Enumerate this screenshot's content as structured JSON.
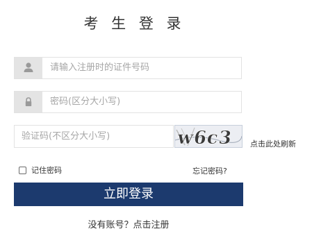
{
  "page": {
    "title": "考 生 登 录"
  },
  "form": {
    "id_number": {
      "placeholder": "请输入注册时的证件号码",
      "icon": "user-icon"
    },
    "password": {
      "placeholder": "密码(区分大小写)",
      "icon": "lock-icon"
    },
    "captcha": {
      "placeholder": "验证码(不区分大小写)",
      "image_text": "w6c3",
      "refresh_label": "点击此处刷新"
    },
    "remember_label": "记住密码",
    "forgot_label": "忘记密码?",
    "submit_label": "立即登录",
    "register_label": "没有账号？点击注册"
  },
  "colors": {
    "button_bg": "#1c3a6e",
    "icon_bg": "#e4e4e4",
    "placeholder": "#a6a6a6"
  }
}
